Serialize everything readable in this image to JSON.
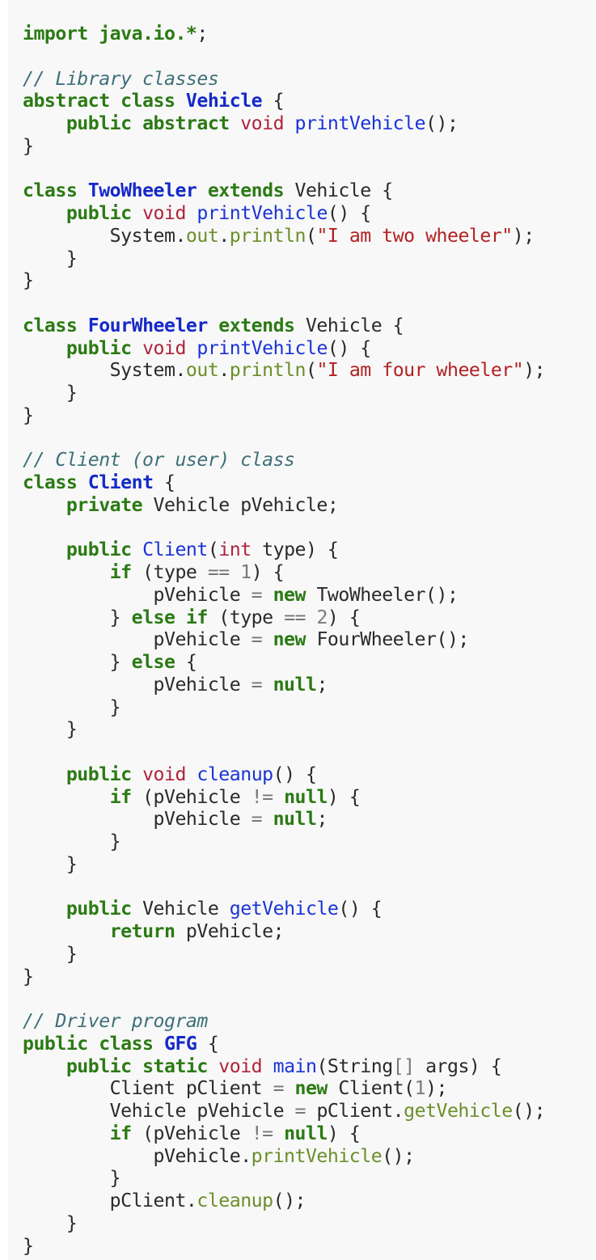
{
  "code_lines": [
    [
      [
        "kw",
        "import java.io.*"
      ],
      [
        "punct",
        ";"
      ]
    ],
    [],
    [
      [
        "comment",
        "// Library classes"
      ]
    ],
    [
      [
        "kw",
        "abstract class "
      ],
      [
        "class",
        "Vehicle"
      ],
      [
        "punct",
        " {"
      ]
    ],
    [
      [
        "plain",
        "    "
      ],
      [
        "kw",
        "public abstract "
      ],
      [
        "type",
        "void "
      ],
      [
        "method",
        "printVehicle"
      ],
      [
        "punct",
        "();"
      ]
    ],
    [
      [
        "punct",
        "}"
      ]
    ],
    [],
    [
      [
        "kw",
        "class "
      ],
      [
        "class",
        "TwoWheeler"
      ],
      [
        "kw",
        " extends "
      ],
      [
        "plain",
        "Vehicle "
      ],
      [
        "punct",
        "{"
      ]
    ],
    [
      [
        "plain",
        "    "
      ],
      [
        "kw",
        "public "
      ],
      [
        "type",
        "void "
      ],
      [
        "method",
        "printVehicle"
      ],
      [
        "punct",
        "() {"
      ]
    ],
    [
      [
        "plain",
        "        System."
      ],
      [
        "call",
        "out"
      ],
      [
        "punct",
        "."
      ],
      [
        "call",
        "println"
      ],
      [
        "punct",
        "("
      ],
      [
        "string",
        "\"I am two wheeler\""
      ],
      [
        "punct",
        ");"
      ]
    ],
    [
      [
        "plain",
        "    "
      ],
      [
        "punct",
        "}"
      ]
    ],
    [
      [
        "punct",
        "}"
      ]
    ],
    [],
    [
      [
        "kw",
        "class "
      ],
      [
        "class",
        "FourWheeler"
      ],
      [
        "kw",
        " extends "
      ],
      [
        "plain",
        "Vehicle "
      ],
      [
        "punct",
        "{"
      ]
    ],
    [
      [
        "plain",
        "    "
      ],
      [
        "kw",
        "public "
      ],
      [
        "type",
        "void "
      ],
      [
        "method",
        "printVehicle"
      ],
      [
        "punct",
        "() {"
      ]
    ],
    [
      [
        "plain",
        "        System."
      ],
      [
        "call",
        "out"
      ],
      [
        "punct",
        "."
      ],
      [
        "call",
        "println"
      ],
      [
        "punct",
        "("
      ],
      [
        "string",
        "\"I am four wheeler\""
      ],
      [
        "punct",
        ");"
      ]
    ],
    [
      [
        "plain",
        "    "
      ],
      [
        "punct",
        "}"
      ]
    ],
    [
      [
        "punct",
        "}"
      ]
    ],
    [],
    [
      [
        "comment",
        "// Client (or user) class"
      ]
    ],
    [
      [
        "kw",
        "class "
      ],
      [
        "class",
        "Client"
      ],
      [
        "punct",
        " {"
      ]
    ],
    [
      [
        "plain",
        "    "
      ],
      [
        "kw",
        "private "
      ],
      [
        "plain",
        "Vehicle pVehicle;"
      ]
    ],
    [],
    [
      [
        "plain",
        "    "
      ],
      [
        "kw",
        "public "
      ],
      [
        "method",
        "Client"
      ],
      [
        "punct",
        "("
      ],
      [
        "type",
        "int "
      ],
      [
        "plain",
        "type) {"
      ]
    ],
    [
      [
        "plain",
        "        "
      ],
      [
        "kw",
        "if "
      ],
      [
        "plain",
        "(type "
      ],
      [
        "op",
        "== "
      ],
      [
        "number",
        "1"
      ],
      [
        "plain",
        ") {"
      ]
    ],
    [
      [
        "plain",
        "            pVehicle "
      ],
      [
        "op",
        "= "
      ],
      [
        "kw",
        "new "
      ],
      [
        "plain",
        "TwoWheeler();"
      ]
    ],
    [
      [
        "plain",
        "        } "
      ],
      [
        "kw",
        "else if "
      ],
      [
        "plain",
        "(type "
      ],
      [
        "op",
        "== "
      ],
      [
        "number",
        "2"
      ],
      [
        "plain",
        ") {"
      ]
    ],
    [
      [
        "plain",
        "            pVehicle "
      ],
      [
        "op",
        "= "
      ],
      [
        "kw",
        "new "
      ],
      [
        "plain",
        "FourWheeler();"
      ]
    ],
    [
      [
        "plain",
        "        } "
      ],
      [
        "kw",
        "else "
      ],
      [
        "plain",
        "{"
      ]
    ],
    [
      [
        "plain",
        "            pVehicle "
      ],
      [
        "op",
        "= "
      ],
      [
        "kw",
        "null"
      ],
      [
        "plain",
        ";"
      ]
    ],
    [
      [
        "plain",
        "        }"
      ]
    ],
    [
      [
        "plain",
        "    }"
      ]
    ],
    [],
    [
      [
        "plain",
        "    "
      ],
      [
        "kw",
        "public "
      ],
      [
        "type",
        "void "
      ],
      [
        "method",
        "cleanup"
      ],
      [
        "punct",
        "() {"
      ]
    ],
    [
      [
        "plain",
        "        "
      ],
      [
        "kw",
        "if "
      ],
      [
        "plain",
        "(pVehicle "
      ],
      [
        "op",
        "!= "
      ],
      [
        "kw",
        "null"
      ],
      [
        "plain",
        ") {"
      ]
    ],
    [
      [
        "plain",
        "            pVehicle "
      ],
      [
        "op",
        "= "
      ],
      [
        "kw",
        "null"
      ],
      [
        "plain",
        ";"
      ]
    ],
    [
      [
        "plain",
        "        }"
      ]
    ],
    [
      [
        "plain",
        "    }"
      ]
    ],
    [],
    [
      [
        "plain",
        "    "
      ],
      [
        "kw",
        "public "
      ],
      [
        "plain",
        "Vehicle "
      ],
      [
        "method",
        "getVehicle"
      ],
      [
        "punct",
        "() {"
      ]
    ],
    [
      [
        "plain",
        "        "
      ],
      [
        "kw",
        "return "
      ],
      [
        "plain",
        "pVehicle;"
      ]
    ],
    [
      [
        "plain",
        "    }"
      ]
    ],
    [
      [
        "punct",
        "}"
      ]
    ],
    [],
    [
      [
        "comment",
        "// Driver program"
      ]
    ],
    [
      [
        "kw",
        "public class "
      ],
      [
        "class",
        "GFG"
      ],
      [
        "punct",
        " {"
      ]
    ],
    [
      [
        "plain",
        "    "
      ],
      [
        "kw",
        "public static "
      ],
      [
        "type",
        "void "
      ],
      [
        "method",
        "main"
      ],
      [
        "plain",
        "(String"
      ],
      [
        "op",
        "[]"
      ],
      [
        "plain",
        " args) {"
      ]
    ],
    [
      [
        "plain",
        "        Client pClient "
      ],
      [
        "op",
        "= "
      ],
      [
        "kw",
        "new "
      ],
      [
        "plain",
        "Client("
      ],
      [
        "number",
        "1"
      ],
      [
        "plain",
        ");"
      ]
    ],
    [
      [
        "plain",
        "        Vehicle pVehicle "
      ],
      [
        "op",
        "= "
      ],
      [
        "plain",
        "pClient."
      ],
      [
        "call",
        "getVehicle"
      ],
      [
        "plain",
        "();"
      ]
    ],
    [
      [
        "plain",
        "        "
      ],
      [
        "kw",
        "if "
      ],
      [
        "plain",
        "(pVehicle "
      ],
      [
        "op",
        "!= "
      ],
      [
        "kw",
        "null"
      ],
      [
        "plain",
        ") {"
      ]
    ],
    [
      [
        "plain",
        "            pVehicle."
      ],
      [
        "call",
        "printVehicle"
      ],
      [
        "plain",
        "();"
      ]
    ],
    [
      [
        "plain",
        "        }"
      ]
    ],
    [
      [
        "plain",
        "        pClient."
      ],
      [
        "call",
        "cleanup"
      ],
      [
        "plain",
        "();"
      ]
    ],
    [
      [
        "plain",
        "    }"
      ]
    ],
    [
      [
        "punct",
        "}"
      ]
    ]
  ],
  "colors": {
    "background": "#f8f8f8",
    "keyword": "#2b7a14",
    "type": "#b0233a",
    "class_name": "#1529c9",
    "method": "#1a33d6",
    "call": "#6b8f2a",
    "string": "#b22222",
    "comment": "#3e7078"
  }
}
